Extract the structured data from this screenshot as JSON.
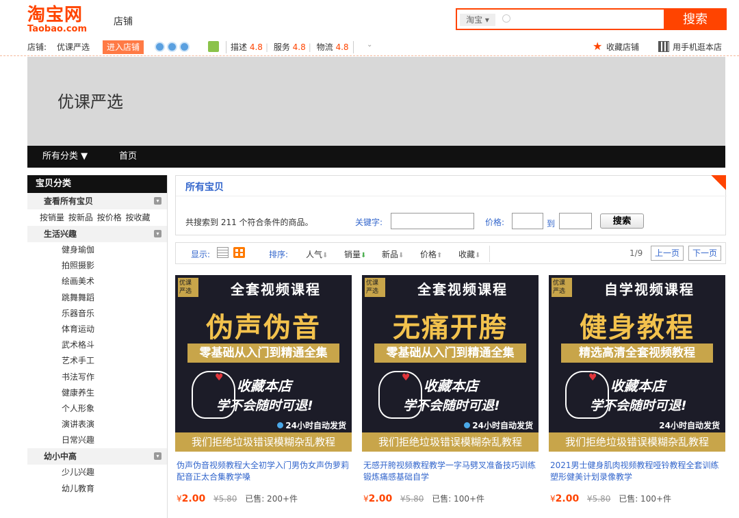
{
  "header": {
    "logo_cn": "淘宝网",
    "logo_en": "Taobao.com",
    "store_label": "店铺",
    "search": {
      "scope": "淘宝",
      "placeholder": "",
      "button": "搜索"
    },
    "brand_color": "#ff4400"
  },
  "shopinfo": {
    "shop_prefix": "店铺:",
    "shop_name": "优课严选",
    "enter_button": "进入店铺",
    "ratings": [
      {
        "label": "描述",
        "value": "4.8"
      },
      {
        "label": "服务",
        "value": "4.8"
      },
      {
        "label": "物流",
        "value": "4.8"
      }
    ],
    "favorite": "收藏店铺",
    "mobile": "用手机逛本店"
  },
  "banner": {
    "title": "优课严选"
  },
  "navbar": {
    "all_categories": "所有分类 ▼",
    "home": "首页"
  },
  "sidebar": {
    "title": "宝贝分类",
    "view_all": "查看所有宝贝",
    "sort_links": [
      "按销量",
      "按新品",
      "按价格",
      "按收藏"
    ],
    "group1": {
      "name": "生活兴趣",
      "items": [
        "健身瑜伽",
        "拍照摄影",
        "绘画美术",
        "跳舞舞蹈",
        "乐器音乐",
        "体育运动",
        "武术格斗",
        "艺术手工",
        "书法写作",
        "健康养生",
        "个人形象",
        "演讲表演",
        "日常兴趣"
      ]
    },
    "group2": {
      "name": "幼小中高",
      "items": [
        "少儿兴趣",
        "幼儿教育"
      ]
    }
  },
  "main": {
    "breadcrumb": "所有宝贝",
    "result_count": "共搜索到 211 个符合条件的商品。",
    "keyword_label": "关键字:",
    "price_label": "价格:",
    "to_label": "到",
    "filter_button": "搜索",
    "sortbar": {
      "display_label": "显示:",
      "sort_label": "排序:",
      "options": [
        "人气",
        "销量",
        "新品",
        "价格",
        "收藏"
      ],
      "page": "1/9",
      "prev": "上一页",
      "next": "下一页"
    }
  },
  "products": [
    {
      "badge": "优课严选",
      "subtitle": "全套视频课程",
      "headline": "伪声伪音",
      "ribbon": "零基础从入门到精通全集",
      "line1": "收藏本店",
      "line2": "学不会随时可退!",
      "ship": "24小时自动发货",
      "footer": "我们拒绝垃圾错误模糊杂乱教程",
      "title": "伪声伪音视频教程大全初学入门男伪女声伪萝莉配音正太合集教学嗓",
      "currency": "¥",
      "price": "2.00",
      "original": "¥5.80",
      "sold": "已售: 200+件"
    },
    {
      "badge": "优课严选",
      "subtitle": "全套视频课程",
      "headline": "无痛开胯",
      "ribbon": "零基础从入门到精通全集",
      "line1": "收藏本店",
      "line2": "学不会随时可退!",
      "ship": "24小时自动发货",
      "footer": "我们拒绝垃圾错误模糊杂乱教程",
      "title": "无感开胯视频教程教学一字马劈叉准备技巧训练锻炼痛感基础自学",
      "currency": "¥",
      "price": "2.00",
      "original": "¥5.80",
      "sold": "已售: 100+件"
    },
    {
      "badge": "优课严选",
      "subtitle": "自学视频课程",
      "headline": "健身教程",
      "ribbon": "精选高清全套视频教程",
      "line1": "收藏本店",
      "line2": "学不会随时可退!",
      "ship": "24小时自动发货",
      "footer": "我们拒绝垃圾错误模糊杂乱教程",
      "title": "2021男士健身肌肉视频教程哑铃教程全套训练塑形健美计划录像教学",
      "currency": "¥",
      "price": "2.00",
      "original": "¥5.80",
      "sold": "已售: 100+件"
    }
  ]
}
